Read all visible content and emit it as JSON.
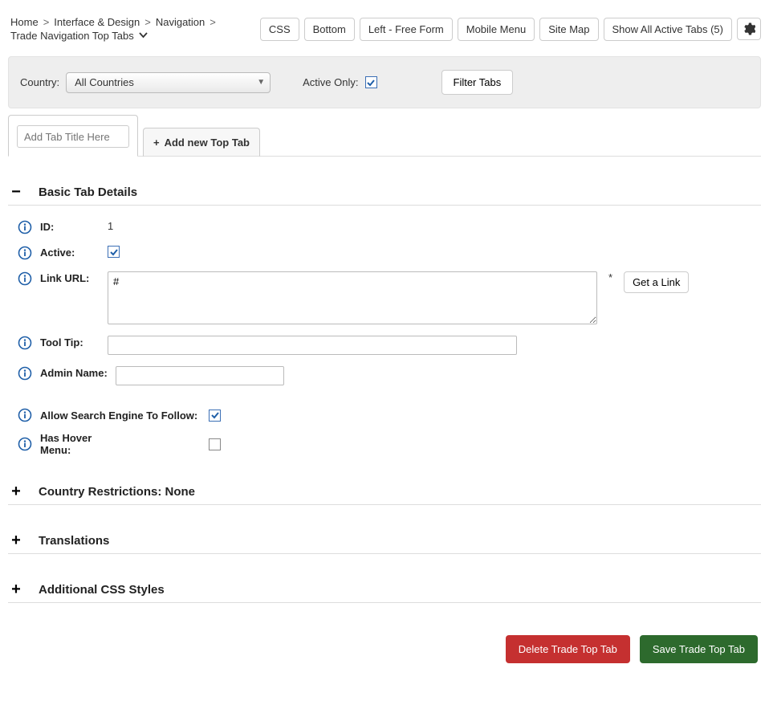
{
  "breadcrumb": {
    "items": [
      "Home",
      "Interface & Design",
      "Navigation"
    ],
    "current": "Trade Navigation Top Tabs"
  },
  "toolbar": {
    "buttons": [
      "CSS",
      "Bottom",
      "Left - Free Form",
      "Mobile Menu",
      "Site Map",
      "Show All Active Tabs (5)"
    ]
  },
  "filter": {
    "country_label": "Country:",
    "country_value": "All Countries",
    "active_only_label": "Active Only:",
    "active_only_checked": true,
    "filter_button": "Filter Tabs"
  },
  "tabs": {
    "title_placeholder": "Add Tab Title Here",
    "add_label": "Add new Top Tab"
  },
  "sections": {
    "basic": {
      "title": "Basic Tab Details",
      "id_label": "ID:",
      "id_value": "1",
      "active_label": "Active:",
      "active_checked": true,
      "link_label": "Link URL:",
      "link_value": "#",
      "get_link": "Get a Link",
      "tooltip_label": "Tool Tip:",
      "tooltip_value": "",
      "admin_label": "Admin Name:",
      "admin_value": "",
      "allow_search_label": "Allow Search Engine To Follow:",
      "allow_search_checked": true,
      "hover_label": "Has Hover Menu:",
      "hover_checked": false
    },
    "country": {
      "title": "Country Restrictions: None"
    },
    "translations": {
      "title": "Translations"
    },
    "styles": {
      "title": "Additional CSS Styles"
    }
  },
  "footer": {
    "delete": "Delete Trade Top Tab",
    "save": "Save Trade Top Tab"
  }
}
